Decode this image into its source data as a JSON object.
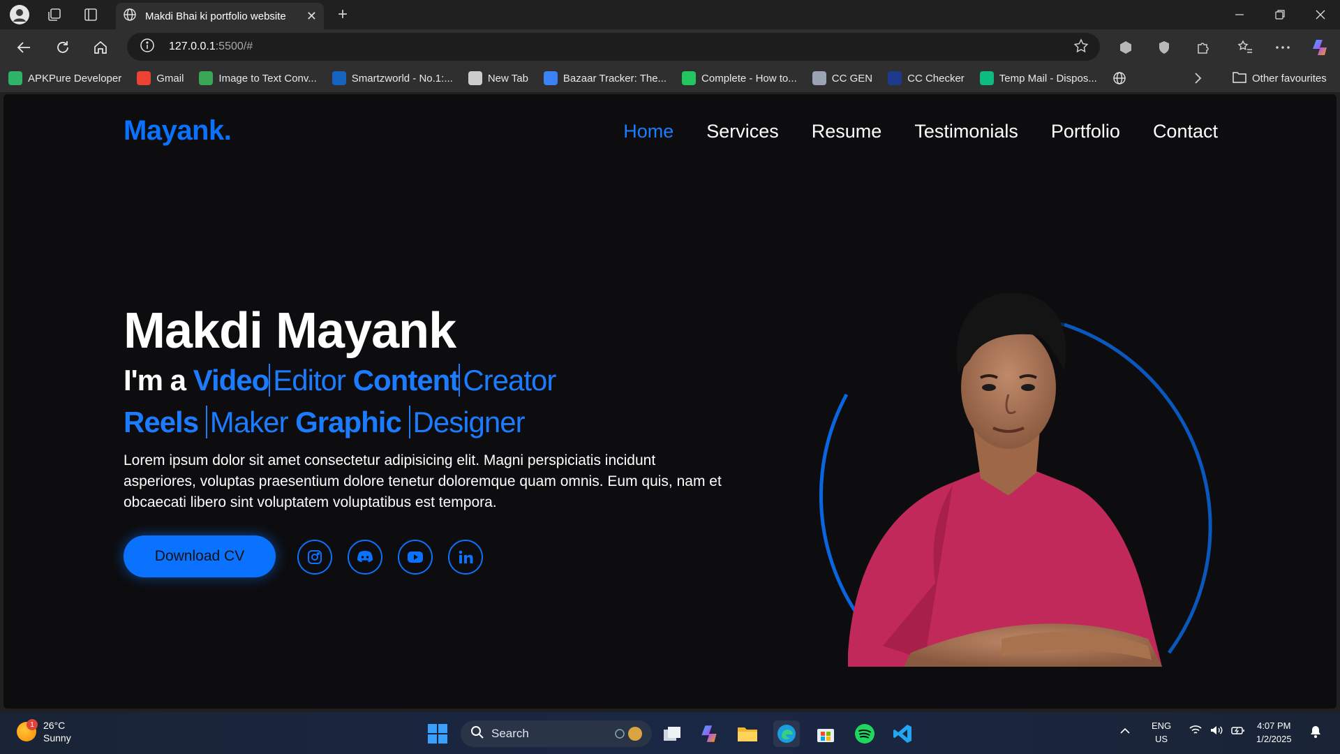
{
  "browser": {
    "tab_title": "Makdi Bhai ki portfolio website",
    "new_tab_symbol": "+",
    "url_host": "127.0.0.1",
    "url_rest": ":5500/#",
    "bookmarks": [
      {
        "label": "APKPure Developer",
        "icon": "apkpure-icon",
        "color": "#2fb36b"
      },
      {
        "label": "Gmail",
        "icon": "gmail-icon",
        "color": "#ea4335"
      },
      {
        "label": "Image to Text Conv...",
        "icon": "image-to-text-icon",
        "color": "#3aa757"
      },
      {
        "label": "Smartzworld - No.1:...",
        "icon": "smartzworld-icon",
        "color": "#1565c0"
      },
      {
        "label": "New Tab",
        "icon": "globe-icon",
        "color": "#cccccc"
      },
      {
        "label": "Bazaar Tracker: The...",
        "icon": "bazaar-icon",
        "color": "#3b82f6"
      },
      {
        "label": "Complete - How to...",
        "icon": "complete-icon",
        "color": "#22c55e"
      },
      {
        "label": "CC GEN",
        "icon": "ccgen-icon",
        "color": "#9aa4b2"
      },
      {
        "label": "CC Checker",
        "icon": "cc-checker-icon",
        "color": "#1e3a8a"
      },
      {
        "label": "Temp Mail - Dispos...",
        "icon": "temp-mail-icon",
        "color": "#10b981"
      }
    ],
    "other_favourites": "Other favourites"
  },
  "site": {
    "logo": "Mayank.",
    "nav": [
      "Home",
      "Services",
      "Resume",
      "Testimonials",
      "Portfolio",
      "Contact"
    ],
    "name": "Makdi Mayank",
    "intro": "I'm a",
    "role_words_line1": [
      "Video",
      "Editor",
      "Content",
      "Creator"
    ],
    "role_words_line2": [
      "Reels",
      "Maker",
      "Graphic",
      "Designer"
    ],
    "description": "Lorem ipsum dolor sit amet consectetur adipisicing elit. Magni perspiciatis incidunt asperiores, voluptas praesentium dolore tenetur doloremque quam omnis. Eum quis, nam et obcaecati libero sint voluptatem voluptatibus est tempora.",
    "cta": "Download CV",
    "socials": [
      "instagram-icon",
      "discord-icon",
      "youtube-icon",
      "linkedin-icon"
    ],
    "colors": {
      "accent": "#0a72ff",
      "background": "#0d0d0f"
    }
  },
  "taskbar": {
    "temperature": "26°C",
    "weather": "Sunny",
    "weather_badge": "1",
    "search_placeholder": "Search",
    "lang": "ENG",
    "region": "US",
    "time": "4:07 PM",
    "date": "1/2/2025"
  }
}
